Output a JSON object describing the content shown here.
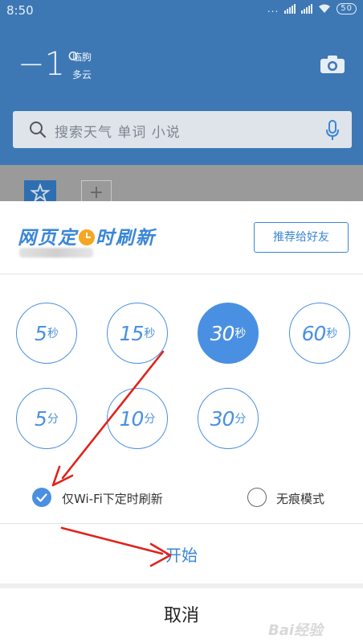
{
  "status_bar": {
    "time": "8:50",
    "dots": "...",
    "battery": "50"
  },
  "weather": {
    "temperature": "−1°",
    "location": "临朐",
    "condition": "多云"
  },
  "search": {
    "placeholder": "搜索天气 单词 小说"
  },
  "background": {
    "plus": "+"
  },
  "sheet": {
    "logo_before": "网页定",
    "logo_after": "时刷新",
    "recommend_label": "推荐给好友",
    "options": [
      {
        "num": "5",
        "unit": "秒",
        "selected": false
      },
      {
        "num": "15",
        "unit": "秒",
        "selected": false
      },
      {
        "num": "30",
        "unit": "秒",
        "selected": true
      },
      {
        "num": "60",
        "unit": "秒",
        "selected": false
      },
      {
        "num": "5",
        "unit": "分",
        "selected": false
      },
      {
        "num": "10",
        "unit": "分",
        "selected": false
      },
      {
        "num": "30",
        "unit": "分",
        "selected": false
      }
    ],
    "wifi_only_label": "仅Wi-Fi下定时刷新",
    "wifi_only_checked": true,
    "incognito_label": "无痕模式",
    "incognito_checked": false,
    "start_label": "开始",
    "cancel_label": "取消"
  },
  "colors": {
    "accent": "#4a90e2",
    "header": "#3d78b5",
    "arrow": "#e0221b",
    "clock": "#f5a623"
  },
  "icons": [
    "search-icon",
    "mic-icon",
    "camera-icon",
    "star-icon",
    "clock-icon",
    "check-icon"
  ],
  "watermark": "Bai经验"
}
